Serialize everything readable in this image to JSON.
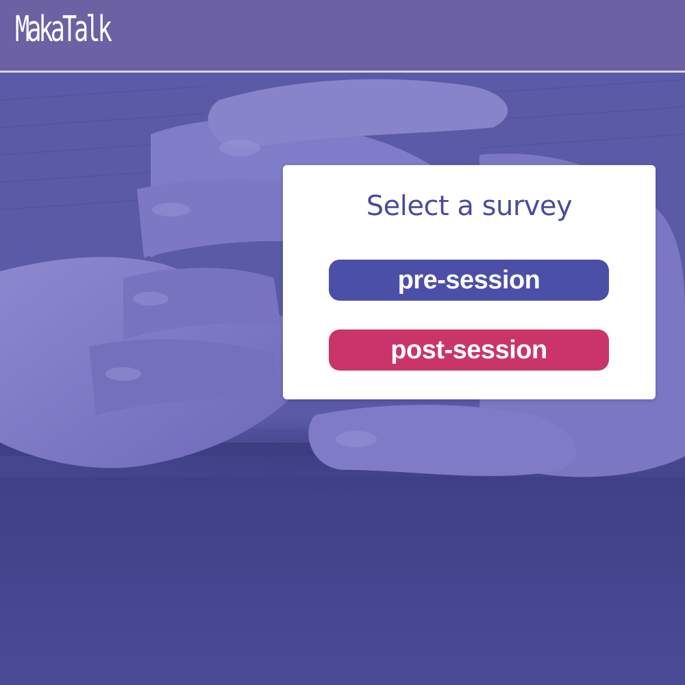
{
  "header": {
    "logo_text": "MakaTalk"
  },
  "survey_card": {
    "title": "Select a survey",
    "buttons": [
      {
        "label": "pre-session",
        "color": "#4c4fa8"
      },
      {
        "label": "post-session",
        "color": "#c93568"
      }
    ]
  },
  "theme": {
    "header_bg": "#6b61a3",
    "overlay": "#5a5aa8",
    "title_color": "#4a4a9e"
  }
}
